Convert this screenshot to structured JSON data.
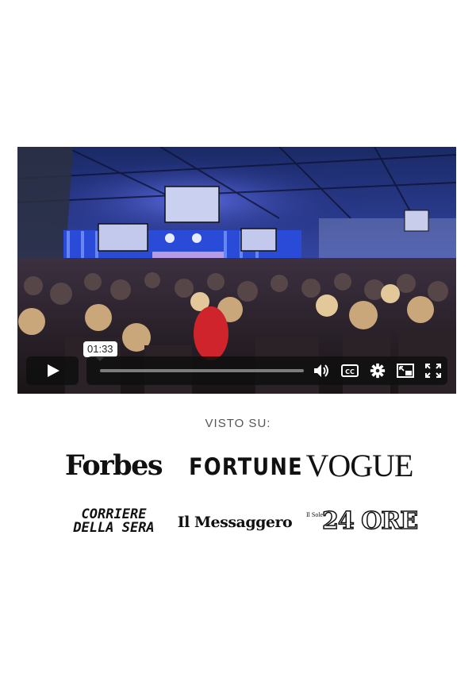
{
  "video": {
    "tooltip_time": "01:33",
    "progress": 0.0,
    "controls": [
      "play-icon",
      "volume-icon",
      "captions-icon",
      "settings-icon",
      "picture-in-picture-icon",
      "fullscreen-icon"
    ],
    "captions_label": "CC"
  },
  "press": {
    "label": "VISTO SU:",
    "logos": {
      "forbes": "Forbes",
      "fortune": "FORTUNE",
      "vogue": "VOGUE",
      "corriere_line1": "CORRIERE",
      "corriere_line2": "DELLA SERA",
      "messaggero": "Il Messaggero",
      "sole_small": "Il Sole",
      "sole_big": "24 ORE"
    }
  },
  "colors": {
    "stage_blue": "#2a4bd8",
    "controls_bg": "#0f0f0f"
  }
}
